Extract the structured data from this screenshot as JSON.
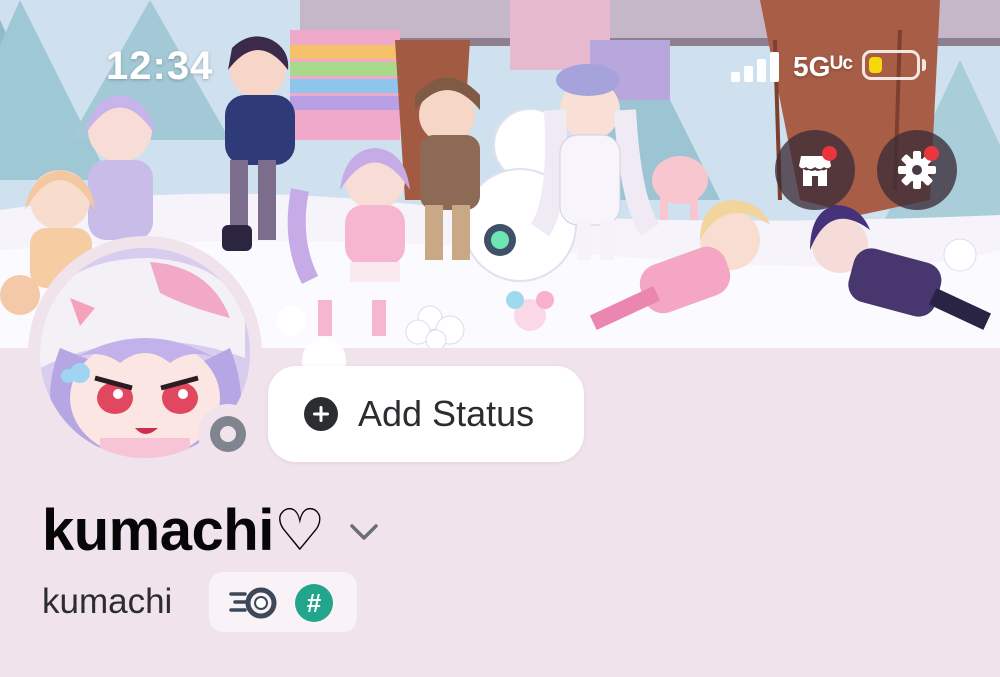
{
  "status_bar": {
    "time": "12:34",
    "network": "5Gᵁᶜ",
    "battery_level": 0.3,
    "battery_color": "#f5d90a"
  },
  "header": {
    "shop_icon": "shop-icon",
    "settings_icon": "gear-icon",
    "notification_dot_color": "#e8363c"
  },
  "profile": {
    "presence": "offline",
    "add_status_label": "Add Status",
    "display_name": "kumachi♡",
    "username": "kumachi",
    "badges": [
      "nitro-speed-badge",
      "hashtag-badge"
    ],
    "hash_badge_glyph": "#"
  },
  "colors": {
    "background": "#f1e3ec",
    "status_pill": "#ffffff",
    "hash_badge": "#23a58d",
    "text_primary": "#060607"
  }
}
